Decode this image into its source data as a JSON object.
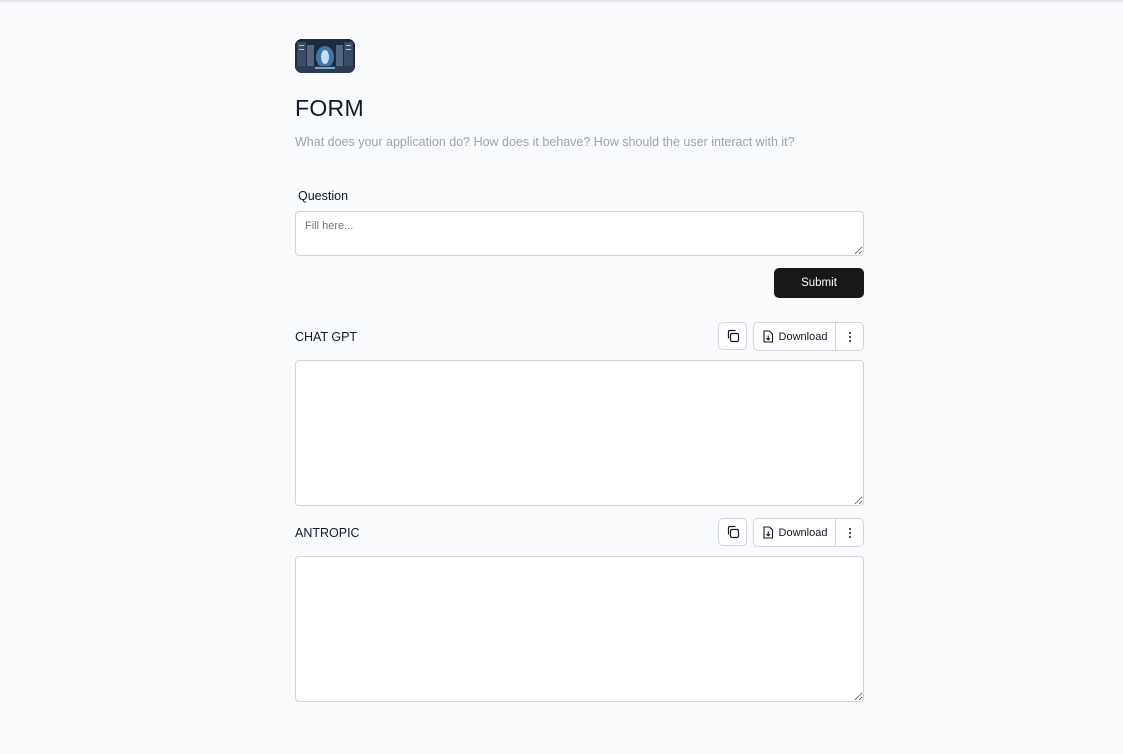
{
  "header": {
    "logo_icon": "futuristic-server-room-image",
    "title": "FORM",
    "description": "What does your application do? How does it behave? How should the user interact with it?"
  },
  "question": {
    "label": "Question",
    "placeholder": "Fill here...",
    "value": ""
  },
  "submit_label": "Submit",
  "outputs": [
    {
      "label": "CHAT GPT",
      "copy_icon": "copy-icon",
      "download_label": "Download",
      "download_icon": "file-download-icon",
      "more_icon": "more-vertical-icon",
      "value": ""
    },
    {
      "label": "ANTROPIC",
      "copy_icon": "copy-icon",
      "download_label": "Download",
      "download_icon": "file-download-icon",
      "more_icon": "more-vertical-icon",
      "value": ""
    }
  ],
  "colors": {
    "background": "#f9fafb",
    "primary_button": "#18181b",
    "border": "#d1d5db",
    "muted_text": "#9ca3af"
  }
}
